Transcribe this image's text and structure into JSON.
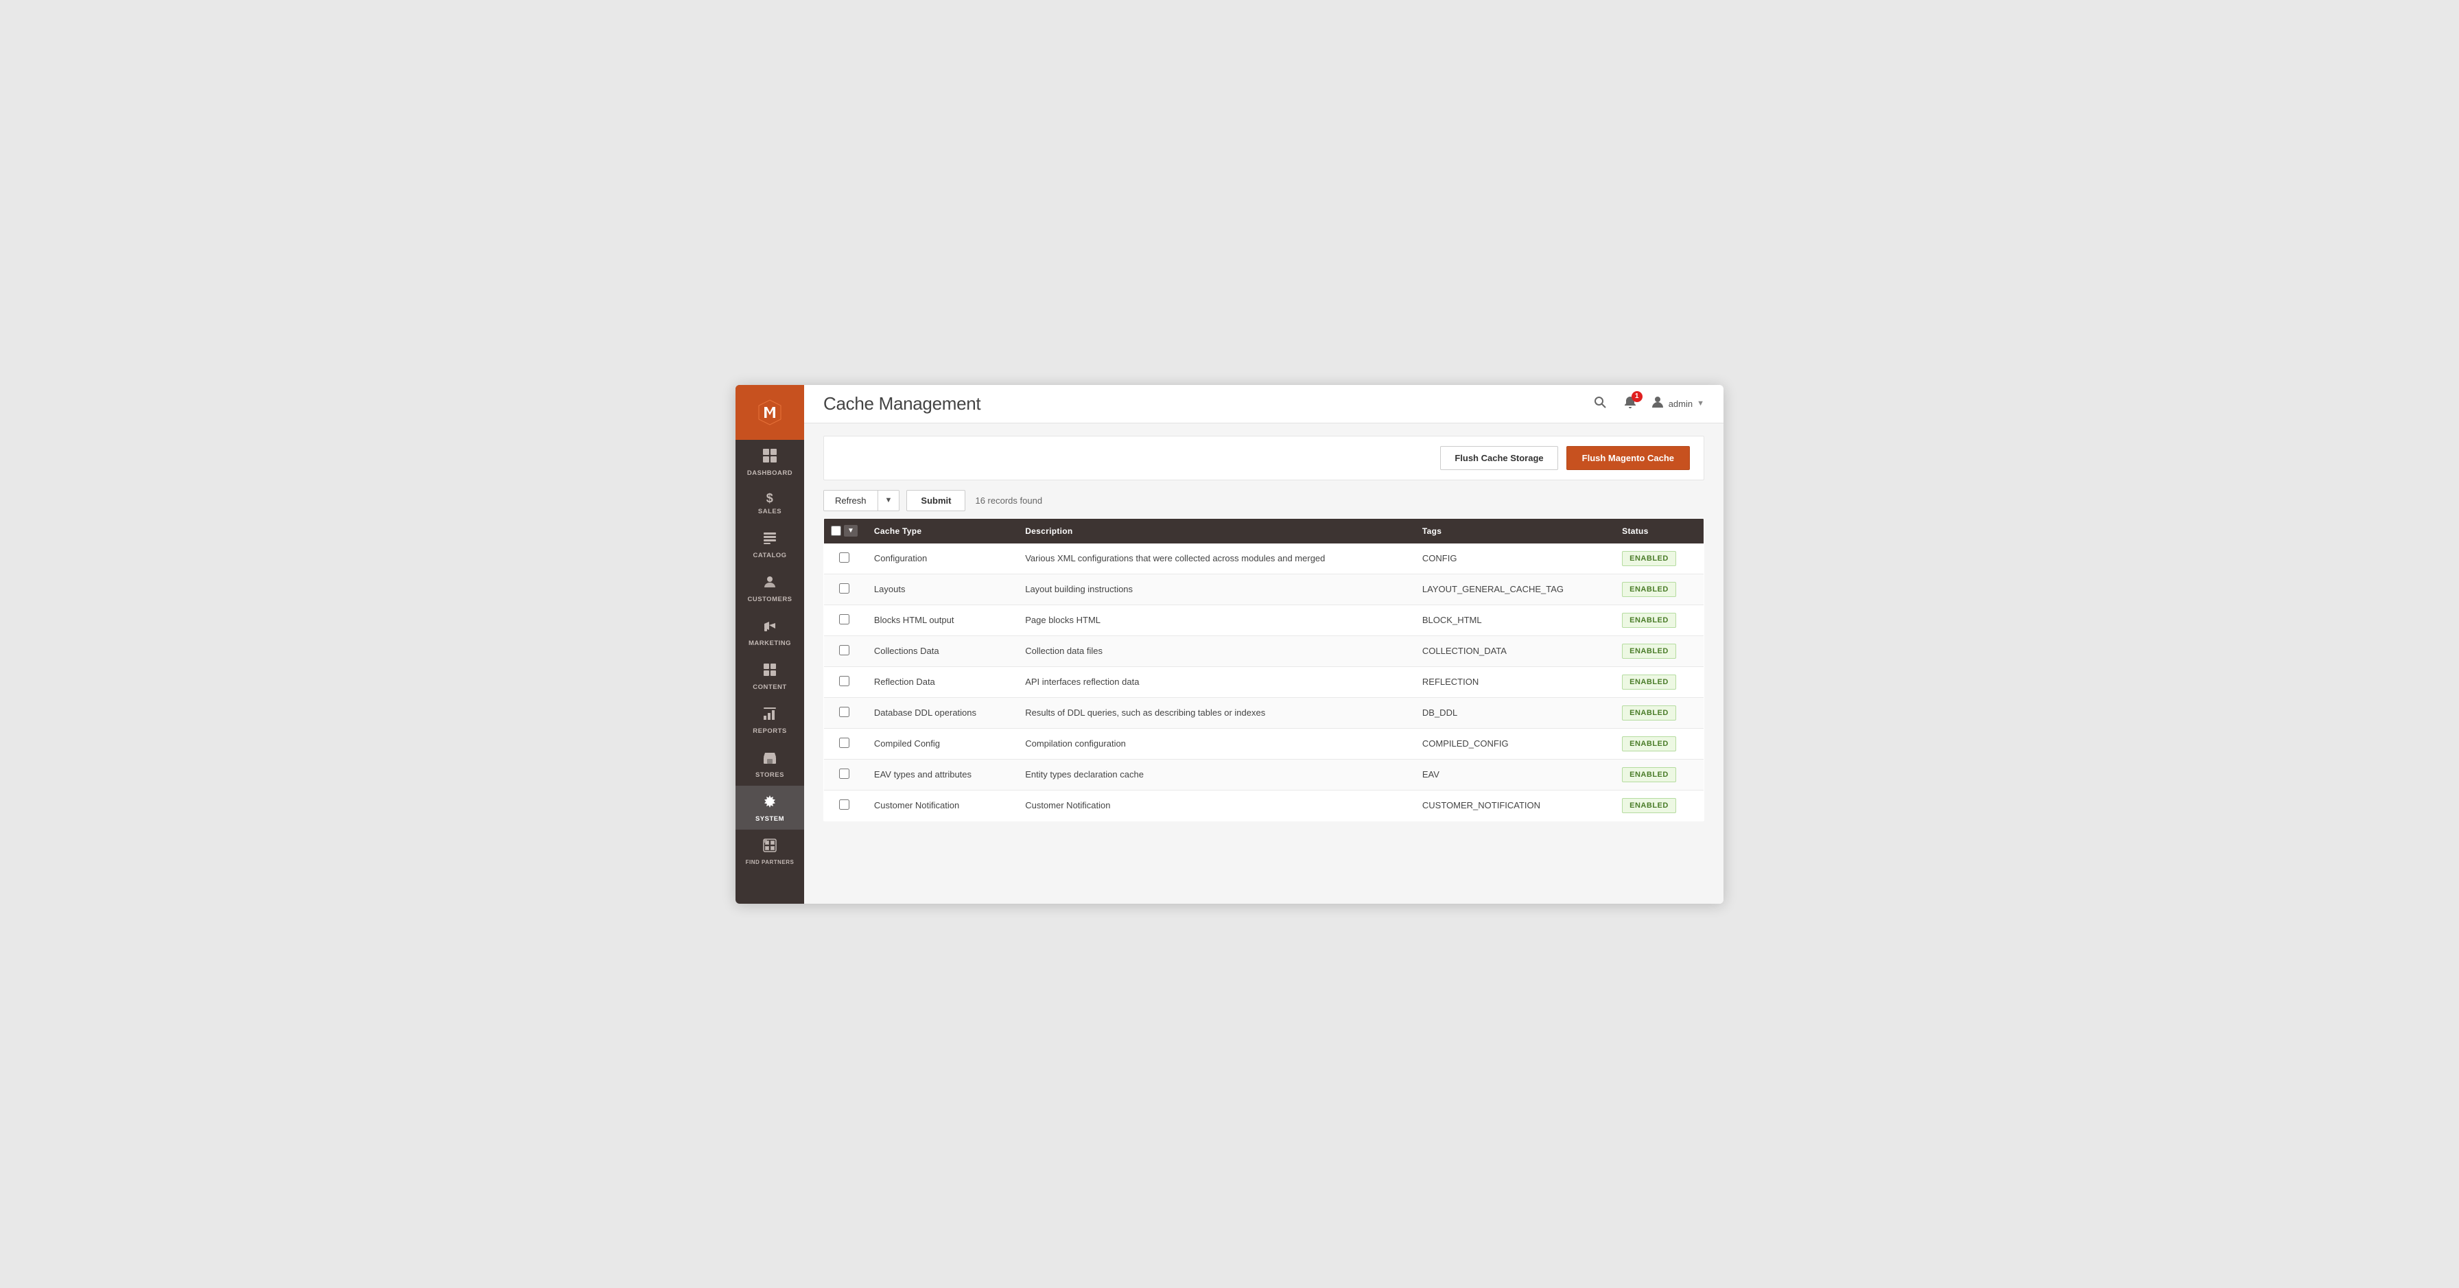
{
  "sidebar": {
    "logo_label": "Magento",
    "items": [
      {
        "id": "dashboard",
        "label": "DASHBOARD",
        "icon": "⊞"
      },
      {
        "id": "sales",
        "label": "SALES",
        "icon": "$"
      },
      {
        "id": "catalog",
        "label": "CATALOG",
        "icon": "📦"
      },
      {
        "id": "customers",
        "label": "CUSTOMERS",
        "icon": "👤"
      },
      {
        "id": "marketing",
        "label": "MARKETING",
        "icon": "📢"
      },
      {
        "id": "content",
        "label": "CONTENT",
        "icon": "▦"
      },
      {
        "id": "reports",
        "label": "REPORTS",
        "icon": "📊"
      },
      {
        "id": "stores",
        "label": "STORES",
        "icon": "🏪"
      },
      {
        "id": "system",
        "label": "SYSTEM",
        "icon": "⚙"
      },
      {
        "id": "findpartners",
        "label": "FIND PARTNERS",
        "icon": "🧩"
      }
    ]
  },
  "header": {
    "title": "Cache Management",
    "search_label": "Search",
    "notification_count": "1",
    "user_name": "admin"
  },
  "actions": {
    "flush_storage_label": "Flush Cache Storage",
    "flush_magento_label": "Flush Magento Cache"
  },
  "toolbar": {
    "refresh_label": "Refresh",
    "submit_label": "Submit",
    "records_found": "16 records found"
  },
  "table": {
    "columns": [
      {
        "id": "checkbox",
        "label": ""
      },
      {
        "id": "cache_type",
        "label": "Cache Type"
      },
      {
        "id": "description",
        "label": "Description"
      },
      {
        "id": "tags",
        "label": "Tags"
      },
      {
        "id": "status",
        "label": "Status"
      }
    ],
    "rows": [
      {
        "cache_type": "Configuration",
        "description": "Various XML configurations that were collected across modules and merged",
        "tags": "CONFIG",
        "status": "ENABLED"
      },
      {
        "cache_type": "Layouts",
        "description": "Layout building instructions",
        "tags": "LAYOUT_GENERAL_CACHE_TAG",
        "status": "ENABLED"
      },
      {
        "cache_type": "Blocks HTML output",
        "description": "Page blocks HTML",
        "tags": "BLOCK_HTML",
        "status": "ENABLED"
      },
      {
        "cache_type": "Collections Data",
        "description": "Collection data files",
        "tags": "COLLECTION_DATA",
        "status": "ENABLED"
      },
      {
        "cache_type": "Reflection Data",
        "description": "API interfaces reflection data",
        "tags": "REFLECTION",
        "status": "ENABLED"
      },
      {
        "cache_type": "Database DDL operations",
        "description": "Results of DDL queries, such as describing tables or indexes",
        "tags": "DB_DDL",
        "status": "ENABLED"
      },
      {
        "cache_type": "Compiled Config",
        "description": "Compilation configuration",
        "tags": "COMPILED_CONFIG",
        "status": "ENABLED"
      },
      {
        "cache_type": "EAV types and attributes",
        "description": "Entity types declaration cache",
        "tags": "EAV",
        "status": "ENABLED"
      },
      {
        "cache_type": "Customer Notification",
        "description": "Customer Notification",
        "tags": "CUSTOMER_NOTIFICATION",
        "status": "ENABLED"
      }
    ]
  }
}
